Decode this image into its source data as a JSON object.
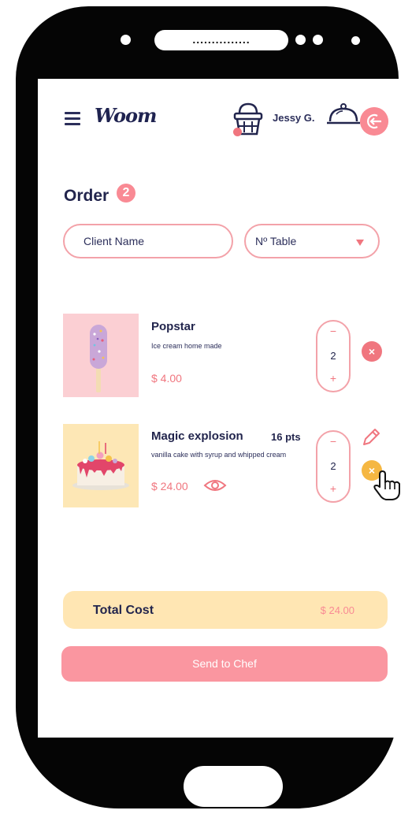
{
  "device": {
    "speaker_dots": "..............."
  },
  "header": {
    "menu_icon": "menu-icon",
    "logo_text": "Woom",
    "cart_icon": "basket-icon",
    "user_name": "Jessy G.",
    "service_icon": "cloche-icon",
    "logout_icon": "logout-icon"
  },
  "order": {
    "title": "Order",
    "count": "2",
    "client_placeholder": "Client Name",
    "table_label": "Nº Table"
  },
  "items": [
    {
      "name": "Popstar",
      "description": "Ice cream home made",
      "price": "$ 4.00",
      "quantity": "2",
      "minus": "−",
      "plus": "+",
      "remove": "×"
    },
    {
      "name": "Magic explosion",
      "points": "16 pts",
      "description": "vanilla cake with syrup and whipped cream",
      "price": "$ 24.00",
      "quantity": "2",
      "minus": "−",
      "plus": "+",
      "remove": "×"
    }
  ],
  "summary": {
    "total_label": "Total Cost",
    "total_value": "$ 24.00",
    "send_button": "Send to Chef"
  },
  "colors": {
    "accent_pink": "#f98a94",
    "border_pink": "#f3a2a9",
    "navy": "#22254d",
    "total_bg": "#ffe6b3",
    "remove_pink": "#f0767f",
    "remove_yellow": "#f5b742"
  }
}
